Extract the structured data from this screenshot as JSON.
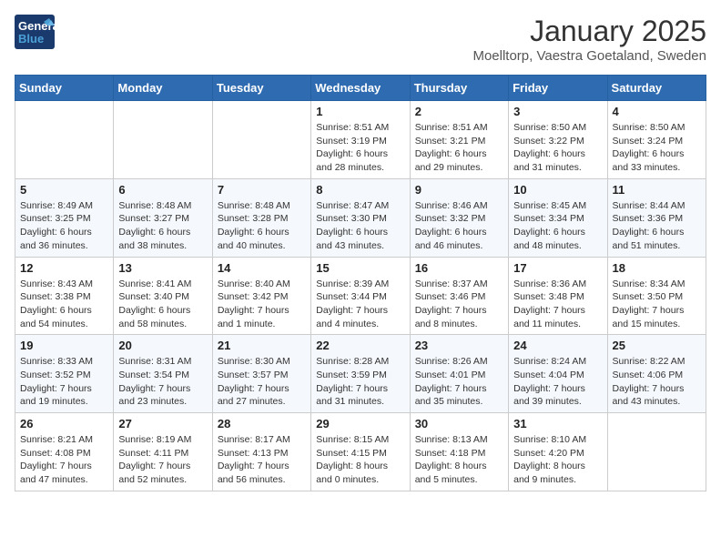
{
  "header": {
    "logo_general": "General",
    "logo_blue": "Blue",
    "month": "January 2025",
    "location": "Moelltorp, Vaestra Goetaland, Sweden"
  },
  "days_of_week": [
    "Sunday",
    "Monday",
    "Tuesday",
    "Wednesday",
    "Thursday",
    "Friday",
    "Saturday"
  ],
  "weeks": [
    [
      {
        "day": "",
        "info": ""
      },
      {
        "day": "",
        "info": ""
      },
      {
        "day": "",
        "info": ""
      },
      {
        "day": "1",
        "info": "Sunrise: 8:51 AM\nSunset: 3:19 PM\nDaylight: 6 hours\nand 28 minutes."
      },
      {
        "day": "2",
        "info": "Sunrise: 8:51 AM\nSunset: 3:21 PM\nDaylight: 6 hours\nand 29 minutes."
      },
      {
        "day": "3",
        "info": "Sunrise: 8:50 AM\nSunset: 3:22 PM\nDaylight: 6 hours\nand 31 minutes."
      },
      {
        "day": "4",
        "info": "Sunrise: 8:50 AM\nSunset: 3:24 PM\nDaylight: 6 hours\nand 33 minutes."
      }
    ],
    [
      {
        "day": "5",
        "info": "Sunrise: 8:49 AM\nSunset: 3:25 PM\nDaylight: 6 hours\nand 36 minutes."
      },
      {
        "day": "6",
        "info": "Sunrise: 8:48 AM\nSunset: 3:27 PM\nDaylight: 6 hours\nand 38 minutes."
      },
      {
        "day": "7",
        "info": "Sunrise: 8:48 AM\nSunset: 3:28 PM\nDaylight: 6 hours\nand 40 minutes."
      },
      {
        "day": "8",
        "info": "Sunrise: 8:47 AM\nSunset: 3:30 PM\nDaylight: 6 hours\nand 43 minutes."
      },
      {
        "day": "9",
        "info": "Sunrise: 8:46 AM\nSunset: 3:32 PM\nDaylight: 6 hours\nand 46 minutes."
      },
      {
        "day": "10",
        "info": "Sunrise: 8:45 AM\nSunset: 3:34 PM\nDaylight: 6 hours\nand 48 minutes."
      },
      {
        "day": "11",
        "info": "Sunrise: 8:44 AM\nSunset: 3:36 PM\nDaylight: 6 hours\nand 51 minutes."
      }
    ],
    [
      {
        "day": "12",
        "info": "Sunrise: 8:43 AM\nSunset: 3:38 PM\nDaylight: 6 hours\nand 54 minutes."
      },
      {
        "day": "13",
        "info": "Sunrise: 8:41 AM\nSunset: 3:40 PM\nDaylight: 6 hours\nand 58 minutes."
      },
      {
        "day": "14",
        "info": "Sunrise: 8:40 AM\nSunset: 3:42 PM\nDaylight: 7 hours\nand 1 minute."
      },
      {
        "day": "15",
        "info": "Sunrise: 8:39 AM\nSunset: 3:44 PM\nDaylight: 7 hours\nand 4 minutes."
      },
      {
        "day": "16",
        "info": "Sunrise: 8:37 AM\nSunset: 3:46 PM\nDaylight: 7 hours\nand 8 minutes."
      },
      {
        "day": "17",
        "info": "Sunrise: 8:36 AM\nSunset: 3:48 PM\nDaylight: 7 hours\nand 11 minutes."
      },
      {
        "day": "18",
        "info": "Sunrise: 8:34 AM\nSunset: 3:50 PM\nDaylight: 7 hours\nand 15 minutes."
      }
    ],
    [
      {
        "day": "19",
        "info": "Sunrise: 8:33 AM\nSunset: 3:52 PM\nDaylight: 7 hours\nand 19 minutes."
      },
      {
        "day": "20",
        "info": "Sunrise: 8:31 AM\nSunset: 3:54 PM\nDaylight: 7 hours\nand 23 minutes."
      },
      {
        "day": "21",
        "info": "Sunrise: 8:30 AM\nSunset: 3:57 PM\nDaylight: 7 hours\nand 27 minutes."
      },
      {
        "day": "22",
        "info": "Sunrise: 8:28 AM\nSunset: 3:59 PM\nDaylight: 7 hours\nand 31 minutes."
      },
      {
        "day": "23",
        "info": "Sunrise: 8:26 AM\nSunset: 4:01 PM\nDaylight: 7 hours\nand 35 minutes."
      },
      {
        "day": "24",
        "info": "Sunrise: 8:24 AM\nSunset: 4:04 PM\nDaylight: 7 hours\nand 39 minutes."
      },
      {
        "day": "25",
        "info": "Sunrise: 8:22 AM\nSunset: 4:06 PM\nDaylight: 7 hours\nand 43 minutes."
      }
    ],
    [
      {
        "day": "26",
        "info": "Sunrise: 8:21 AM\nSunset: 4:08 PM\nDaylight: 7 hours\nand 47 minutes."
      },
      {
        "day": "27",
        "info": "Sunrise: 8:19 AM\nSunset: 4:11 PM\nDaylight: 7 hours\nand 52 minutes."
      },
      {
        "day": "28",
        "info": "Sunrise: 8:17 AM\nSunset: 4:13 PM\nDaylight: 7 hours\nand 56 minutes."
      },
      {
        "day": "29",
        "info": "Sunrise: 8:15 AM\nSunset: 4:15 PM\nDaylight: 8 hours\nand 0 minutes."
      },
      {
        "day": "30",
        "info": "Sunrise: 8:13 AM\nSunset: 4:18 PM\nDaylight: 8 hours\nand 5 minutes."
      },
      {
        "day": "31",
        "info": "Sunrise: 8:10 AM\nSunset: 4:20 PM\nDaylight: 8 hours\nand 9 minutes."
      },
      {
        "day": "",
        "info": ""
      }
    ]
  ]
}
